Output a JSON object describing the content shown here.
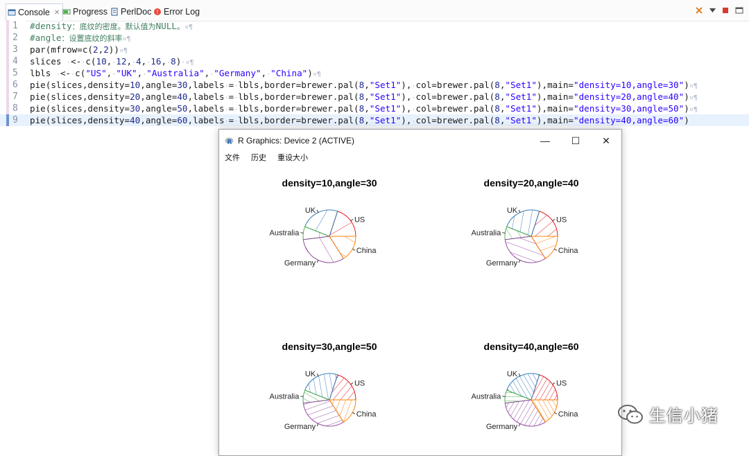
{
  "tabs": [
    {
      "label": "Console",
      "active": true,
      "icon": "console-icon"
    },
    {
      "label": "Progress",
      "active": false,
      "icon": "progress-icon"
    },
    {
      "label": "PerlDoc",
      "active": false,
      "icon": "perldoc-icon"
    },
    {
      "label": "Error Log",
      "active": false,
      "icon": "error-log-icon"
    }
  ],
  "editor": {
    "line_numbers": [
      "1",
      "2",
      "3",
      "4",
      "5",
      "6",
      "7",
      "8",
      "9"
    ]
  },
  "graphics_window": {
    "title": "R Graphics: Device 2 (ACTIVE)",
    "menu": [
      "文件",
      "历史",
      "重设大小"
    ],
    "minimize": "—",
    "maximize": "☐",
    "close": "✕"
  },
  "chart_data": [
    {
      "type": "pie",
      "title": "density=10,angle=30",
      "labels": [
        "US",
        "UK",
        "Australia",
        "Germany",
        "China"
      ],
      "values": [
        10,
        12,
        4,
        16,
        8
      ],
      "density": 10,
      "angle": 30
    },
    {
      "type": "pie",
      "title": "density=20,angle=40",
      "labels": [
        "US",
        "UK",
        "Australia",
        "Germany",
        "China"
      ],
      "values": [
        10,
        12,
        4,
        16,
        8
      ],
      "density": 20,
      "angle": 40
    },
    {
      "type": "pie",
      "title": "density=30,angle=50",
      "labels": [
        "US",
        "UK",
        "Australia",
        "Germany",
        "China"
      ],
      "values": [
        10,
        12,
        4,
        16,
        8
      ],
      "density": 30,
      "angle": 50
    },
    {
      "type": "pie",
      "title": "density=40,angle=60",
      "labels": [
        "US",
        "UK",
        "Australia",
        "Germany",
        "China"
      ],
      "values": [
        10,
        12,
        4,
        16,
        8
      ],
      "density": 40,
      "angle": 60
    }
  ],
  "colors": {
    "set1": [
      "#E41A1C",
      "#377EB8",
      "#4DAF4A",
      "#984EA3",
      "#FF7F00"
    ]
  },
  "watermark": "生信小猪"
}
